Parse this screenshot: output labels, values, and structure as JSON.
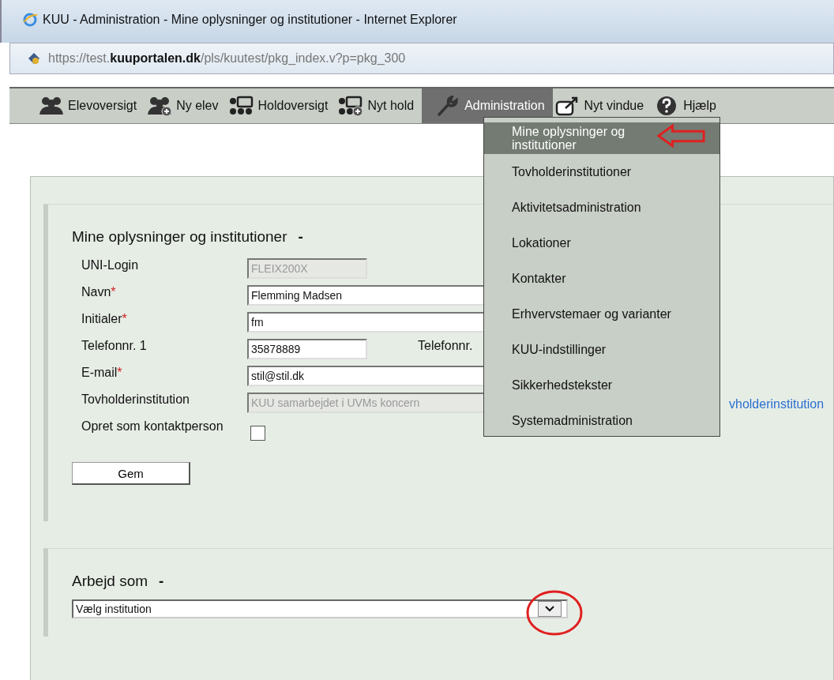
{
  "window": {
    "title": "KUU - Administration - Mine oplysninger og institutioner - Internet Explorer"
  },
  "address": {
    "url": "https://test.**kuuportalen.dk**/pls/kuutest/pkg_index.v?p=pkg_300"
  },
  "toolbar": [
    {
      "label": "Elevoversigt",
      "kind": "group",
      "selected": false
    },
    {
      "label": "Ny elev",
      "kind": "group-add",
      "selected": false
    },
    {
      "label": "Holdoversigt",
      "kind": "team",
      "selected": false
    },
    {
      "label": "Nyt hold",
      "kind": "team-add",
      "selected": false
    },
    {
      "label": "Administration",
      "kind": "wrench",
      "selected": true
    },
    {
      "label": "Nyt vindue",
      "kind": "window",
      "selected": false
    },
    {
      "label": "Hjælp",
      "kind": "help",
      "selected": false
    }
  ],
  "menu": [
    {
      "label": "Mine oplysninger og institutioner",
      "selected": true
    },
    {
      "label": "Tovholderinstitutioner",
      "selected": false
    },
    {
      "label": "Aktivitetsadministration",
      "selected": false
    },
    {
      "label": "Lokationer",
      "selected": false
    },
    {
      "label": "Kontakter",
      "selected": false
    },
    {
      "label": "Erhvervstemaer og varianter",
      "selected": false
    },
    {
      "label": "KUU-indstillinger",
      "selected": false
    },
    {
      "label": "Sikkerhedstekster",
      "selected": false
    },
    {
      "label": "Systemadministration",
      "selected": false
    }
  ],
  "section1": {
    "title": "Mine oplysninger og institutioner",
    "toggle": "-",
    "rows": [
      {
        "label": "UNI-Login",
        "kind": "short",
        "disabled": true,
        "value": "FLEIX200X"
      },
      {
        "label": "Navn",
        "required_mark": "*",
        "kind": "long",
        "disabled": false,
        "value": "Flemming Madsen"
      },
      {
        "label": "Initialer",
        "required_mark": "*",
        "kind": "long",
        "disabled": false,
        "value": "fm"
      },
      {
        "label": "Telefonnr. 1",
        "kind": "short",
        "disabled": false,
        "value": "35878889",
        "extra_label": "Telefonnr."
      },
      {
        "label": "E-mail",
        "required_mark": "*",
        "kind": "long",
        "disabled": false,
        "value": "stil@stil.dk"
      },
      {
        "label": "Tovholderinstitution",
        "kind": "long",
        "disabled": true,
        "value": "KUU samarbejdet i UVMs koncern",
        "link": "vholderinstitution"
      },
      {
        "label": "Opret som kontaktperson",
        "kind": "checkbox",
        "checked": false
      }
    ],
    "button": "Gem"
  },
  "section2": {
    "title": "Arbejd som",
    "toggle": "-",
    "select": {
      "value": "Vælg institution"
    }
  }
}
